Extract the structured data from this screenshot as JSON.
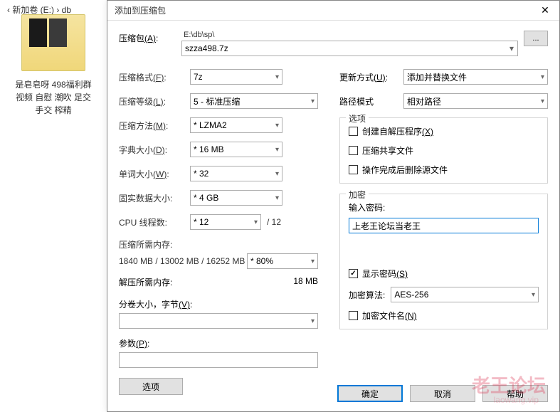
{
  "breadcrumb": "‹ 新加卷 (E:) › db",
  "folder": {
    "name": "是皂皂呀 498福利群视频 自慰 潮吹 足交 手交 榨精"
  },
  "dialog": {
    "title": "添加到压缩包",
    "close_glyph": "✕",
    "archive_label": "压缩包",
    "archive_key": "(A)",
    "archive_root": "E:\\db\\sp\\",
    "archive_name": "szza498.7z",
    "browse_label": "...",
    "left": {
      "format_label": "压缩格式",
      "format_key": "(F)",
      "format_value": "7z",
      "level_label": "压缩等级",
      "level_key": "(L)",
      "level_value": "5 - 标准压缩",
      "method_label": "压缩方法",
      "method_key": "(M)",
      "method_value": "* LZMA2",
      "dict_label": "字典大小",
      "dict_key": "(D)",
      "dict_value": "* 16 MB",
      "word_label": "单词大小",
      "word_key": "(W)",
      "word_value": "* 32",
      "solid_label": "固实数据大小:",
      "solid_value": "* 4 GB",
      "cpu_label": "CPU 线程数:",
      "cpu_value": "* 12",
      "cpu_total": "/ 12",
      "compress_mem_label": "压缩所需内存:",
      "compress_mem_value": "1840 MB / 13002 MB / 16252 MB",
      "compress_pct": "* 80%",
      "decomp_mem_label": "解压所需内存:",
      "decomp_mem_value": "18 MB",
      "split_label": "分卷大小，字节",
      "split_key": "(V)",
      "split_value": "",
      "params_label": "参数",
      "params_key": "(P)",
      "params_value": "",
      "options_btn": "选项"
    },
    "right": {
      "update_label": "更新方式",
      "update_key": "(U)",
      "update_value": "添加并替换文件",
      "path_label": "路径模式",
      "path_value": "相对路径",
      "options_legend": "选项",
      "opt_sfx": "创建自解压程序",
      "opt_sfx_key": "(X)",
      "opt_shared": "压缩共享文件",
      "opt_delete": "操作完成后删除源文件",
      "encrypt_legend": "加密",
      "pw_label": "输入密码:",
      "pw_value": "上老王论坛当老王",
      "show_pw": "显示密码",
      "show_pw_key": "(S)",
      "algo_label": "加密算法:",
      "algo_value": "AES-256",
      "encrypt_names": "加密文件名",
      "encrypt_names_key": "(N)"
    },
    "footer": {
      "ok": "确定",
      "cancel": "取消",
      "help": "帮助"
    }
  },
  "watermark": {
    "main": "老王论坛",
    "sub": "laowang.vip"
  }
}
